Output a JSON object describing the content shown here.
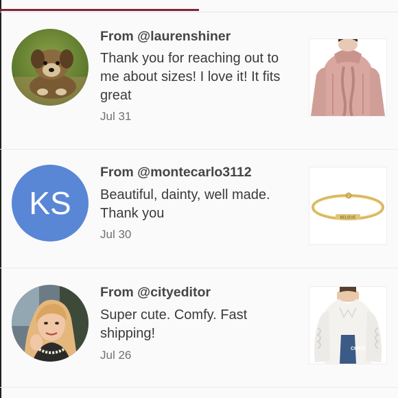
{
  "reviews": [
    {
      "from": "From @laurenshiner",
      "text": "Thank you for reaching out to me about sizes! I love it! It fits great",
      "date": "Jul 31",
      "avatar_icon": "dog-photo",
      "thumb_icon": "pink-knit-sweater-photo"
    },
    {
      "from": "From @montecarlo3112",
      "text": "Beautiful, dainty, well made. Thank you",
      "date": "Jul 30",
      "avatar_initials": "KS",
      "avatar_color": "#5a86d6",
      "thumb_icon": "gold-bracelet-photo",
      "thumb_engraving": "BELIEVE"
    },
    {
      "from": "From @cityeditor",
      "text": "Super cute. Comfy. Fast shipping!",
      "date": "Jul 26",
      "avatar_icon": "woman-portrait-photo",
      "thumb_icon": "white-ruffle-blouse-photo",
      "thumb_watermark": "CHICE"
    }
  ],
  "colors": {
    "tab_indicator": "#7f2336",
    "background": "#fbfafb"
  }
}
